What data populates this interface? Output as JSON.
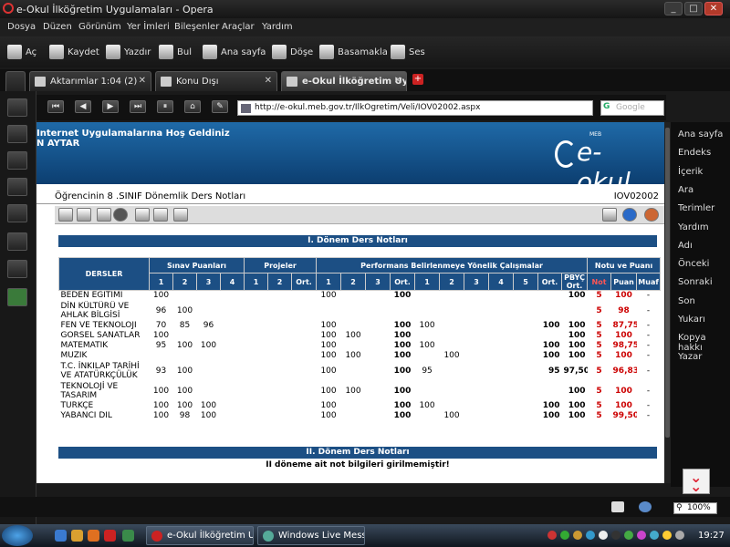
{
  "window": {
    "title": "e-Okul İlköğretim Uygulamaları - Opera"
  },
  "menu": [
    "Dosya",
    "Düzen",
    "Görünüm",
    "Yer İmleri",
    "Bileşenler",
    "Araçlar",
    "Yardım"
  ],
  "toolbar": [
    "Aç",
    "Kaydet",
    "Yazdır",
    "Bul",
    "Ana sayfa",
    "Döşe",
    "Basamakla",
    "Ses"
  ],
  "tabs": [
    {
      "label": "Aktarımlar 1:04 (2)"
    },
    {
      "label": "Konu Dışı"
    },
    {
      "label": "e-Okul İlköğretim Uyg..."
    }
  ],
  "address": {
    "url": "http://e-okul.meb.gov.tr/IlkOgretim/Veli/IOV02002.aspx",
    "search_placeholder": "Google"
  },
  "right_panel": [
    "Ana sayfa",
    "Endeks",
    "İçerik",
    "Ara",
    "Terimler",
    "Yardım",
    "Adı",
    "Önceki",
    "Sonraki",
    "Son",
    "Yukarı",
    "Kopya hakkı",
    "Yazar"
  ],
  "page": {
    "welcome": "Internet Uygulamalarına Hoş Geldiniz",
    "name": "N AYTAR",
    "logo_meb": "MEB",
    "logo": "e-okul",
    "subtitle": "Öğrencinin 8 .SINIF Dönemlik Ders Notları",
    "page_code": "IOV02002",
    "sem1_title": "I. Dönem Ders Notları",
    "sem2_title": "II. Dönem Ders Notları",
    "sem2_msg": "II döneme ait not bilgileri girilmemiştir!",
    "headers": {
      "dersler": "DERSLER",
      "sinav": "Sınav Puanları",
      "projeler": "Projeler",
      "performans": "Performans Belirlenmeye Yönelik Çalışmalar",
      "notu": "Notu ve Puanı",
      "n1": "1",
      "n2": "2",
      "n3": "3",
      "n4": "4",
      "n5": "5",
      "ort": "Ort.",
      "pbyc": "PBYÇ Ort.",
      "not": "Not",
      "puan": "Puan",
      "muaf": "Muaf"
    },
    "rows": [
      {
        "ders": "BEDEN EĞİTİMİ",
        "s": [
          "100",
          "",
          "",
          ""
        ],
        "p": [
          "",
          "",
          ""
        ],
        "f": [
          "100",
          "",
          "",
          ""
        ],
        "fo": "100",
        "q": [
          "",
          "",
          "",
          "",
          ""
        ],
        "qo": "",
        "pbyc": "100",
        "not": "5",
        "puan": "100",
        "muaf": "-"
      },
      {
        "ders": "DİN KÜLTÜRÜ VE AHLAK BİLGİSİ",
        "s": [
          "96",
          "100",
          "",
          ""
        ],
        "p": [
          "",
          "",
          ""
        ],
        "f": [
          "",
          "",
          "",
          ""
        ],
        "fo": "",
        "q": [
          "",
          "",
          "",
          "",
          ""
        ],
        "qo": "",
        "pbyc": "",
        "not": "5",
        "puan": "98",
        "muaf": "-"
      },
      {
        "ders": "FEN VE TEKNOLOJİ",
        "s": [
          "70",
          "85",
          "96",
          ""
        ],
        "p": [
          "",
          "",
          ""
        ],
        "f": [
          "100",
          "",
          "",
          ""
        ],
        "fo": "100",
        "q": [
          "100",
          "",
          "",
          "",
          ""
        ],
        "qo": "100",
        "pbyc": "100",
        "not": "5",
        "puan": "87,75",
        "muaf": "-"
      },
      {
        "ders": "GÖRSEL SANATLAR",
        "s": [
          "100",
          "",
          "",
          ""
        ],
        "p": [
          "",
          "",
          ""
        ],
        "f": [
          "100",
          "100",
          "",
          ""
        ],
        "fo": "100",
        "q": [
          "",
          "",
          "",
          "",
          ""
        ],
        "qo": "",
        "pbyc": "100",
        "not": "5",
        "puan": "100",
        "muaf": "-"
      },
      {
        "ders": "MATEMATİK",
        "s": [
          "95",
          "100",
          "100",
          ""
        ],
        "p": [
          "",
          "",
          ""
        ],
        "f": [
          "100",
          "",
          "",
          ""
        ],
        "fo": "100",
        "q": [
          "100",
          "",
          "",
          "",
          ""
        ],
        "qo": "100",
        "pbyc": "100",
        "not": "5",
        "puan": "98,75",
        "muaf": "-"
      },
      {
        "ders": "MÜZİK",
        "s": [
          "",
          "",
          "",
          ""
        ],
        "p": [
          "",
          "",
          ""
        ],
        "f": [
          "100",
          "100",
          "",
          ""
        ],
        "fo": "100",
        "q": [
          "",
          "100",
          "",
          "",
          ""
        ],
        "qo": "100",
        "pbyc": "100",
        "not": "5",
        "puan": "100",
        "muaf": "-"
      },
      {
        "ders": "T.C. İNKILAP TARİHİ VE ATATÜRKÇÜLÜK",
        "s": [
          "93",
          "100",
          "",
          ""
        ],
        "p": [
          "",
          "",
          ""
        ],
        "f": [
          "100",
          "",
          "",
          ""
        ],
        "fo": "100",
        "q": [
          "95",
          "",
          "",
          "",
          ""
        ],
        "qo": "95",
        "pbyc": "97,50",
        "not": "5",
        "puan": "96,83",
        "muaf": "-"
      },
      {
        "ders": "TEKNOLOJİ VE TASARIM",
        "s": [
          "100",
          "100",
          "",
          ""
        ],
        "p": [
          "",
          "",
          ""
        ],
        "f": [
          "100",
          "100",
          "",
          ""
        ],
        "fo": "100",
        "q": [
          "",
          "",
          "",
          "",
          ""
        ],
        "qo": "",
        "pbyc": "100",
        "not": "5",
        "puan": "100",
        "muaf": "-"
      },
      {
        "ders": "TÜRKÇE",
        "s": [
          "100",
          "100",
          "100",
          ""
        ],
        "p": [
          "",
          "",
          ""
        ],
        "f": [
          "100",
          "",
          "",
          ""
        ],
        "fo": "100",
        "q": [
          "100",
          "",
          "",
          "",
          ""
        ],
        "qo": "100",
        "pbyc": "100",
        "not": "5",
        "puan": "100",
        "muaf": "-"
      },
      {
        "ders": "YABANCI DİL",
        "s": [
          "100",
          "98",
          "100",
          ""
        ],
        "p": [
          "",
          "",
          ""
        ],
        "f": [
          "100",
          "",
          "",
          ""
        ],
        "fo": "100",
        "q": [
          "",
          "100",
          "",
          "",
          ""
        ],
        "qo": "100",
        "pbyc": "100",
        "not": "5",
        "puan": "99,50",
        "muaf": "-"
      }
    ]
  },
  "status": {
    "zoom": "100%"
  },
  "taskbar": {
    "items": [
      "e-Okul İlköğretim Uy...",
      "Windows Live Messe..."
    ],
    "clock": "19:27"
  },
  "colors": {
    "header_blue": "#1c4f84",
    "banner_blue": "#1f6aa8",
    "grade_red": "#cc0000"
  }
}
